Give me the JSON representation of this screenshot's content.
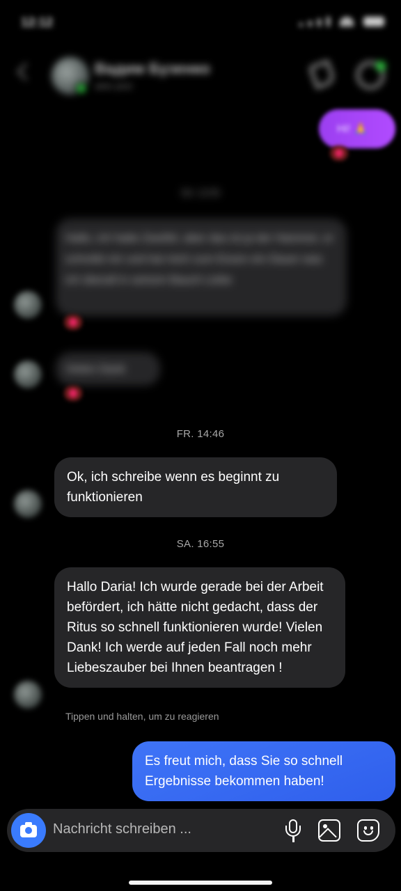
{
  "status_bar": {
    "time": "12:12"
  },
  "header": {
    "name": "Вадим Бузенко",
    "subtitle": "aktiv jetzt"
  },
  "blurred": {
    "outgoing_top": "Hi! 🙏",
    "timestamp_top": "SA. 12:00",
    "message_1": "Hallo, ich hatte Zweifel, aber das ist ja der Hammer, er schreibt mir und hat mich zum Essen ein Dauer was ich überall in seinem Bauch Liebe",
    "message_2": "Vielen Dank"
  },
  "messages": {
    "timestamp_1": "FR. 14:46",
    "incoming_1": "Ok, ich schreibe wenn es beginnt zu funktionieren",
    "timestamp_2": "SA. 16:55",
    "incoming_2": "Hallo Daria! Ich wurde gerade bei der Arbeit befördert, ich hätte nicht gedacht, dass der Ritus so schnell funktionieren wurde! Vielen Dank! Ich werde auf jeden Fall noch mehr Liebeszauber bei Ihnen beantragen !",
    "hint": "Tippen und halten, um zu reagieren",
    "outgoing_1": "Es freut mich, dass Sie so schnell Ergebnisse bekommen haben!"
  },
  "composer": {
    "placeholder": "Nachricht schreiben ..."
  },
  "colors": {
    "outgoing_bubble": "#3b6ff5",
    "incoming_bubble": "#262628",
    "accent": "#3a7bfd"
  }
}
